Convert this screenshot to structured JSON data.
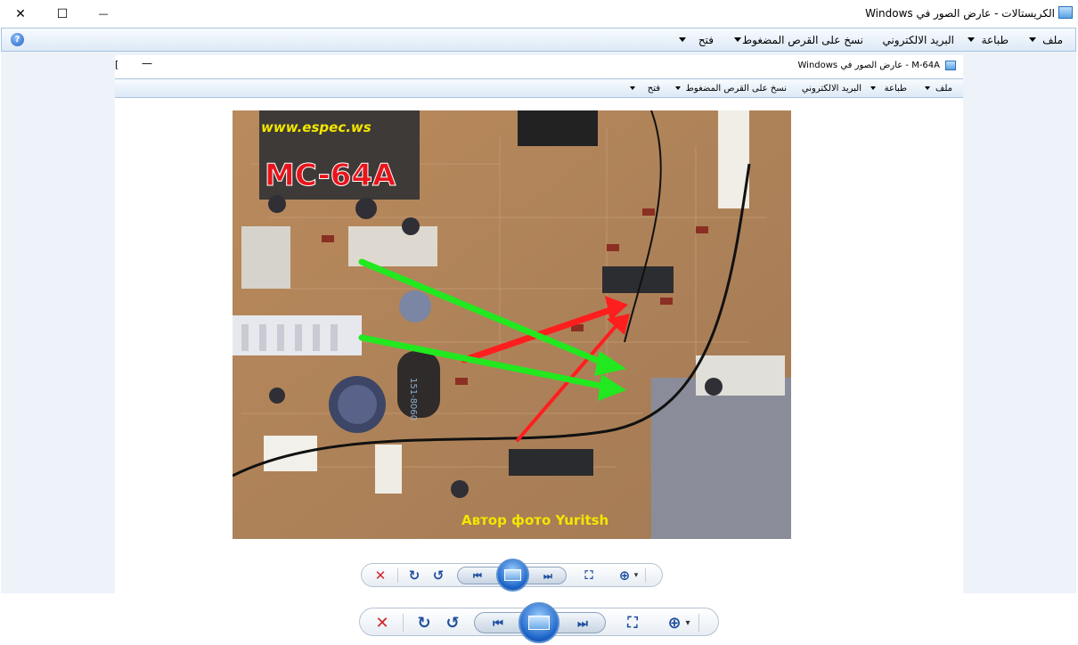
{
  "window": {
    "title": "الكريستالات - عارض الصور في Windows",
    "icon": "photo-viewer-icon",
    "controls": {
      "close": "✕",
      "maximize": "☐",
      "minimize": "—"
    }
  },
  "menubar": {
    "items": [
      {
        "label": "ملف",
        "has_dropdown": true
      },
      {
        "label": "طباعة",
        "has_dropdown": true
      },
      {
        "label": "البريد الالكتروني",
        "has_dropdown": false
      },
      {
        "label": "نسخ على القرص المضغوط",
        "has_dropdown": true
      },
      {
        "label": "فتح",
        "has_dropdown": true
      }
    ],
    "help_icon": "help-icon"
  },
  "inner_window": {
    "title": "M-64A - عارض الصور في Windows",
    "minimize": "—",
    "edge_glyph": "[",
    "menubar": {
      "items": [
        {
          "label": "ملف"
        },
        {
          "label": "طباعة"
        },
        {
          "label": "البريد الالكتروني"
        },
        {
          "label": "نسخ على القرص المضغوط"
        },
        {
          "label": "فتح"
        }
      ]
    }
  },
  "photo": {
    "watermark_top": "www.espec.ws",
    "model_label": "MC-64A",
    "watermark_bottom": "Автор фото Yuritsh",
    "board_marking": "151-8060",
    "colors": {
      "board": "#b98a5c",
      "arrow_red": "#ff1e1e",
      "arrow_green": "#22e81f",
      "label_red": "#e8141c",
      "watermark_yellow": "#f2e600"
    }
  },
  "toolbars": {
    "icons": [
      "delete-icon",
      "rotate-clockwise-icon",
      "rotate-counterclockwise-icon",
      "previous-icon",
      "slideshow-icon",
      "next-icon",
      "actual-size-icon",
      "zoom-icon"
    ],
    "glyphs": {
      "delete": "✕",
      "rotate_cw": "↻",
      "rotate_ccw": "↺",
      "prev": "⏮",
      "next": "⏭",
      "fit": "⛶",
      "zoom": "⊕",
      "zoom_caret": "▾"
    },
    "colors": {
      "delete": "#d2242a",
      "icon_blue": "#1e4f9e"
    }
  }
}
